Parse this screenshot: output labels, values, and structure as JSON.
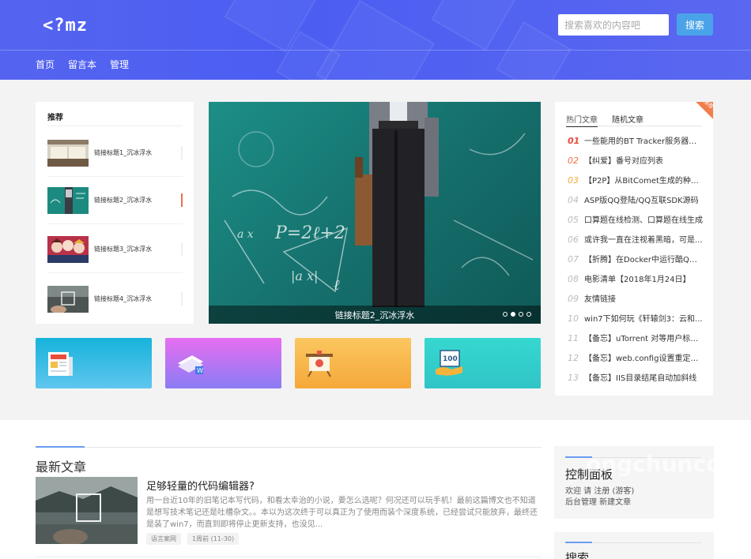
{
  "header": {
    "logo": "<?mz",
    "search_placeholder": "搜索喜欢的内容吧",
    "search_button": "搜索",
    "nav": [
      "首页",
      "留言本",
      "管理"
    ]
  },
  "recommend": {
    "title": "推荐",
    "items": [
      {
        "label": "链接标题1_沉冰浮水",
        "active": false
      },
      {
        "label": "链接标题2_沉冰浮水",
        "active": true
      },
      {
        "label": "链接标题3_沉冰浮水",
        "active": false
      },
      {
        "label": "链接标题4_沉冰浮水",
        "active": false
      }
    ]
  },
  "slider": {
    "caption": "链接标题2_沉冰浮水",
    "slide_count": 4,
    "current_slide": 2,
    "chalk": [
      "P=2ℓ+2",
      "a x",
      "|a x|",
      "ℓ"
    ]
  },
  "tiles": [
    {
      "name": "news",
      "from": "#21b6dd",
      "to": "#63c5ef"
    },
    {
      "name": "word",
      "from": "#e26ef0",
      "to": "#8b7bf5"
    },
    {
      "name": "easel",
      "from": "#fbc55a",
      "to": "#f6ab3c"
    },
    {
      "name": "score",
      "from": "#37d9d0",
      "to": "#35c4c8"
    }
  ],
  "hot": {
    "tabs": [
      "热门文章",
      "随机文章"
    ],
    "ribbon": "推荐",
    "items": [
      {
        "num": "01",
        "text": "一些能用的BT Tracker服务器地..."
      },
      {
        "num": "02",
        "text": "【纠爱】番号对应列表"
      },
      {
        "num": "03",
        "text": "【P2P】从BitComet生成的种子..."
      },
      {
        "num": "04",
        "text": "ASP版QQ登陆/QQ互联SDK源码"
      },
      {
        "num": "05",
        "text": "口算题在线检测、口算题在线生成"
      },
      {
        "num": "06",
        "text": "或许我一直在注视着黑暗，可是..."
      },
      {
        "num": "07",
        "text": "【折腾】在Docker中运行酷Q机..."
      },
      {
        "num": "08",
        "text": "电影清单【2018年1月24日】"
      },
      {
        "num": "09",
        "text": "友情链接"
      },
      {
        "num": "10",
        "text": "win7下如何玩《轩辕剑3：云和..."
      },
      {
        "num": "11",
        "text": "【备忘】uTorrent 对等用户标识..."
      },
      {
        "num": "12",
        "text": "【备忘】web.config设置重定向..."
      },
      {
        "num": "13",
        "text": "【备忘】IIS目录结尾自动加斜线"
      }
    ]
  },
  "latest": {
    "heading": "最新文章",
    "article": {
      "title": "足够轻量的代码编辑器?",
      "excerpt": "用一台近10年的旧笔记本写代码，和看太幸治的小说，要怎么选呢？何况还可以玩手机！最前这篇博文也不知道是想写技术笔记还是吐槽杂文。。本以为这次终于可以真正为了使用而装个深度系统，已经尝试只能放弃，最终还是装了win7，而直到即将停止更新支持，也没见...",
      "tags": [
        "语言案网",
        "1周前 (11-30)"
      ]
    }
  },
  "control_panel": {
    "title": "控制面板",
    "line1": "欢迎 请 注册 (游客)",
    "line2": "后台管理 新建文章",
    "watermark": "ongchuncom"
  },
  "search_panel": {
    "title": "搜索"
  }
}
